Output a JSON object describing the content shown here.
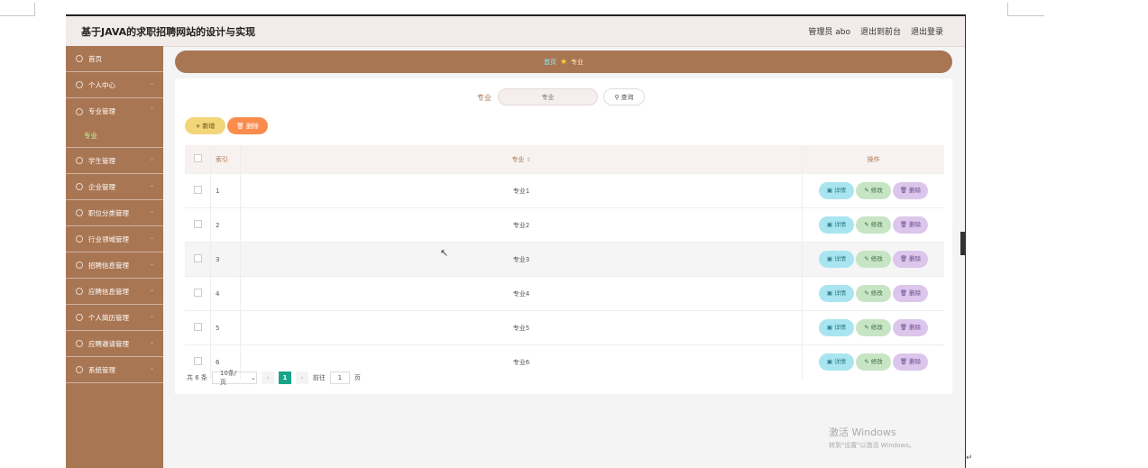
{
  "app": {
    "title": "基于JAVA的求职招聘网站的设计与实现"
  },
  "header": {
    "admin": "管理员 abo",
    "to_front": "退出到前台",
    "logout": "退出登录"
  },
  "sidebar": {
    "items": [
      {
        "label": "首页",
        "icon": "home-icon"
      },
      {
        "label": "个人中心",
        "icon": "user-icon"
      },
      {
        "label": "专业管理",
        "icon": "list-icon"
      },
      {
        "label": "学生管理",
        "icon": "list-icon"
      },
      {
        "label": "企业管理",
        "icon": "list-icon"
      },
      {
        "label": "职位分类管理",
        "icon": "list-icon"
      },
      {
        "label": "行业领域管理",
        "icon": "list-icon"
      },
      {
        "label": "招聘信息管理",
        "icon": "list-icon"
      },
      {
        "label": "应聘信息管理",
        "icon": "list-icon"
      },
      {
        "label": "个人简历管理",
        "icon": "list-icon"
      },
      {
        "label": "应聘邀请管理",
        "icon": "list-icon"
      },
      {
        "label": "系统管理",
        "icon": "user-icon"
      }
    ],
    "sub_item": "专业"
  },
  "breadcrumb": {
    "home": "首页",
    "current": "专业"
  },
  "search": {
    "label": "专业",
    "placeholder": "专业",
    "button": "查询"
  },
  "actions": {
    "add": "新增",
    "delete": "删除"
  },
  "table": {
    "headers": {
      "index": "索引",
      "name": "专业",
      "ops": "操作"
    },
    "op_labels": {
      "detail": "详情",
      "edit": "修改",
      "delete": "删除"
    },
    "rows": [
      {
        "index": "1",
        "name": "专业1"
      },
      {
        "index": "2",
        "name": "专业2"
      },
      {
        "index": "3",
        "name": "专业3"
      },
      {
        "index": "4",
        "name": "专业4"
      },
      {
        "index": "5",
        "name": "专业5"
      },
      {
        "index": "6",
        "name": "专业6"
      }
    ]
  },
  "pagination": {
    "total": "共 6 条",
    "page_size": "10条/页",
    "current_page": "1",
    "goto_label": "前往",
    "goto_value": "1",
    "page_unit": "页"
  },
  "watermark": {
    "title": "激活 Windows",
    "subtitle": "转到\"设置\"以激活 Windows。"
  },
  "colors": {
    "sidebar": "#a97653",
    "accent": "#18a58a",
    "add": "#f3d67a",
    "delete": "#fb8c4d"
  }
}
